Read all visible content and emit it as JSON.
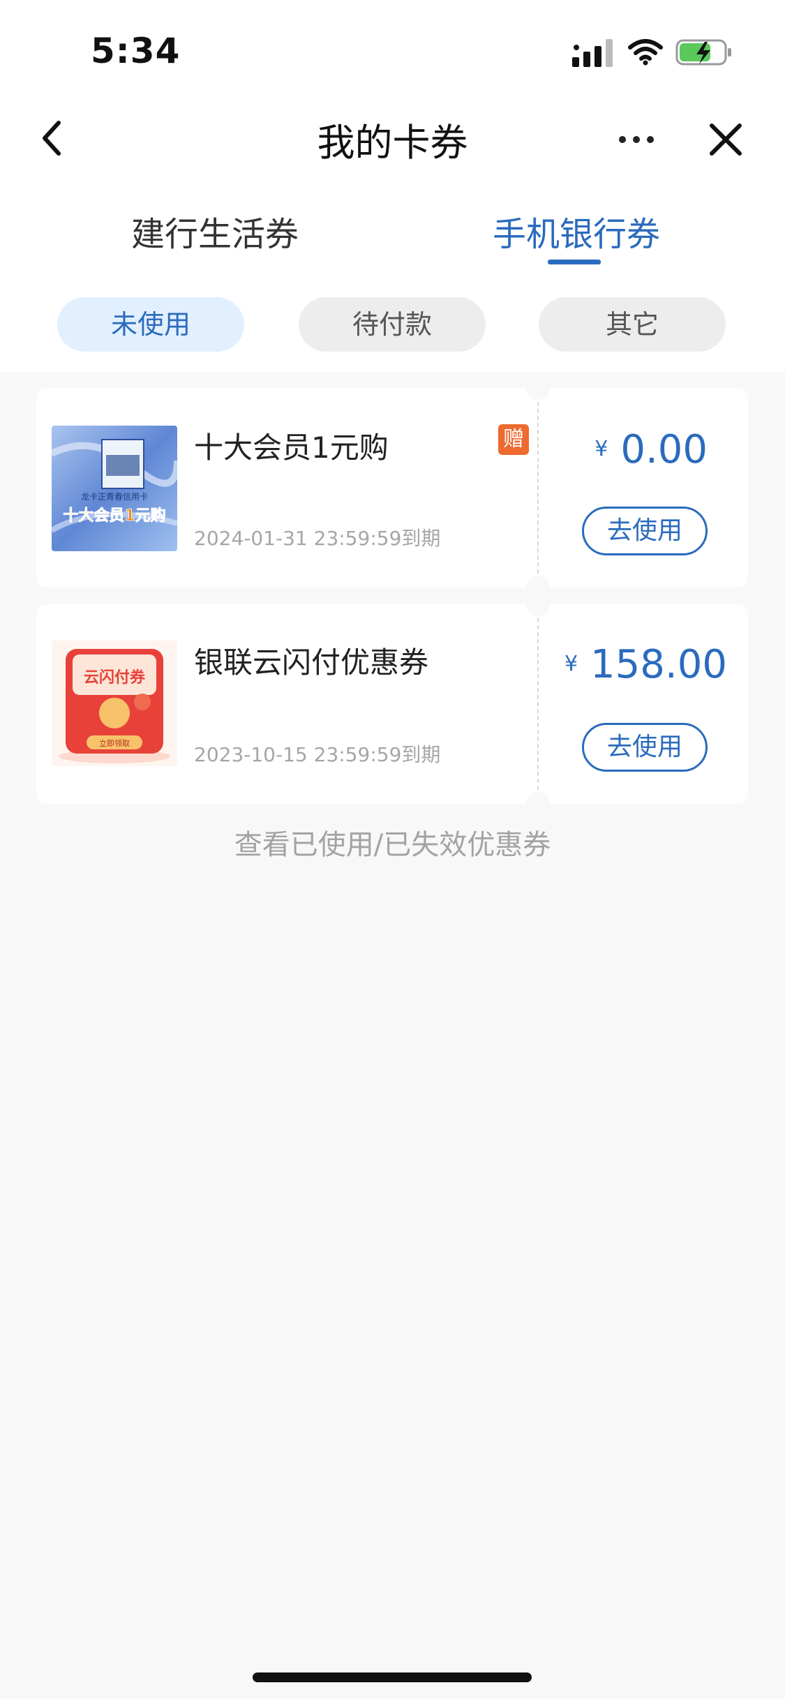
{
  "status_bar": {
    "time": "5:34",
    "battery_icon": "battery-charging-icon",
    "wifi_icon": "wifi-icon",
    "signal_icon": "cellular-signal-icon"
  },
  "nav": {
    "title": "我的卡券",
    "back_icon": "chevron-left-icon",
    "more_icon": "more-horizontal-icon",
    "close_icon": "close-icon"
  },
  "tabs": [
    {
      "label": "建行生活券",
      "active": false
    },
    {
      "label": "手机银行券",
      "active": true
    }
  ],
  "filters": [
    {
      "label": "未使用",
      "active": true
    },
    {
      "label": "待付款",
      "active": false
    },
    {
      "label": "其它",
      "active": false
    }
  ],
  "coupons": [
    {
      "title": "十大会员1元购",
      "badge": "赠",
      "expiry": "2024-01-31 23:59:59到期",
      "currency": "¥",
      "amount": "0.00",
      "action": "去使用",
      "thumb": {
        "line1": "龙卡正青春信用卡",
        "line2": "十大会员1元购"
      }
    },
    {
      "title": "银联云闪付优惠券",
      "expiry": "2023-10-15 23:59:59到期",
      "currency": "¥",
      "amount": "158.00",
      "action": "去使用",
      "thumb": {
        "line1": "云闪付券",
        "line2": "立即领取"
      }
    }
  ],
  "footer_link": "查看已使用/已失效优惠券",
  "colors": {
    "accent": "#2a6bbd",
    "chip_active_bg": "#e2efff",
    "badge": "#ee6a2f",
    "page_bg": "#f8f8f8"
  }
}
